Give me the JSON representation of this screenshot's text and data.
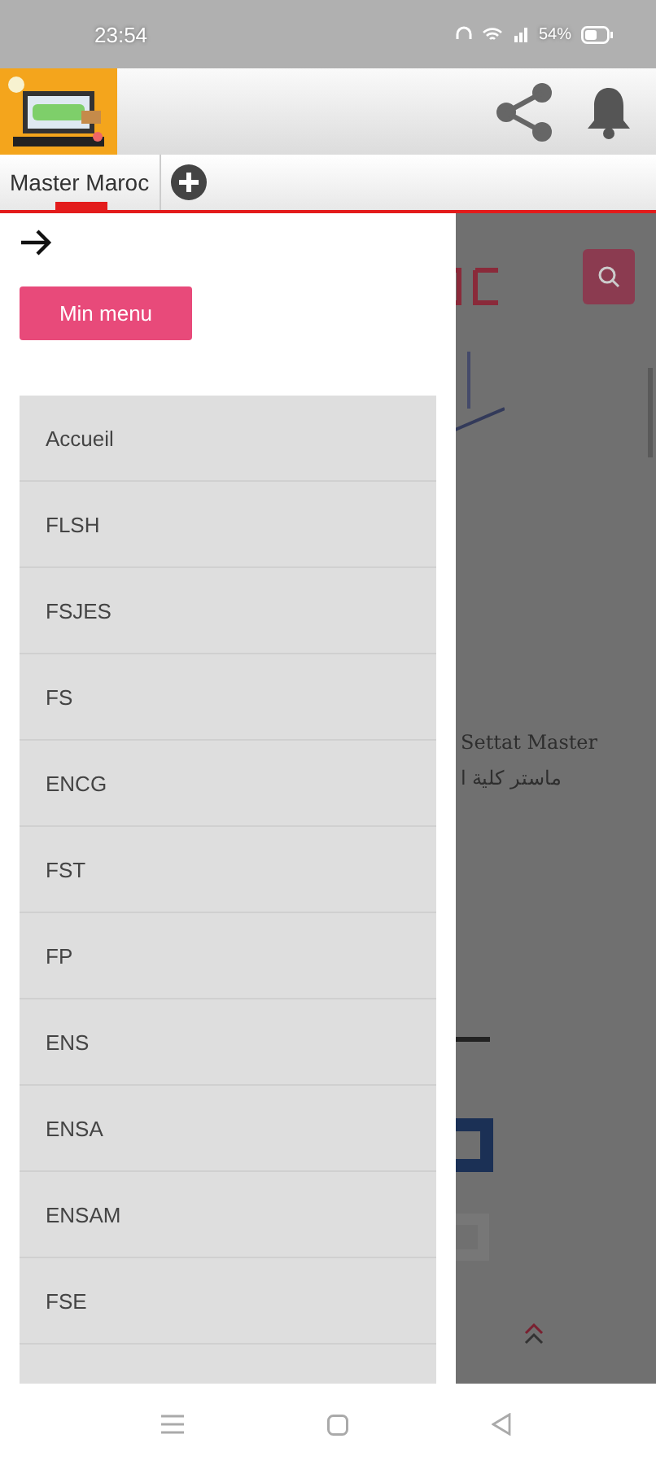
{
  "status_bar": {
    "time": "23:54",
    "battery": "54%"
  },
  "tabs": [
    {
      "label": "Master Maroc",
      "selected": true
    }
  ],
  "drawer": {
    "button": "Min menu",
    "items": [
      "Accueil",
      "FLSH",
      "FSJES",
      "FS",
      "ENCG",
      "FST",
      "FP",
      "ENS",
      "ENSA",
      "ENSAM",
      "FSE"
    ]
  },
  "background_page": {
    "texts": [
      "Settat Master",
      "ماستر كلية ا"
    ]
  }
}
